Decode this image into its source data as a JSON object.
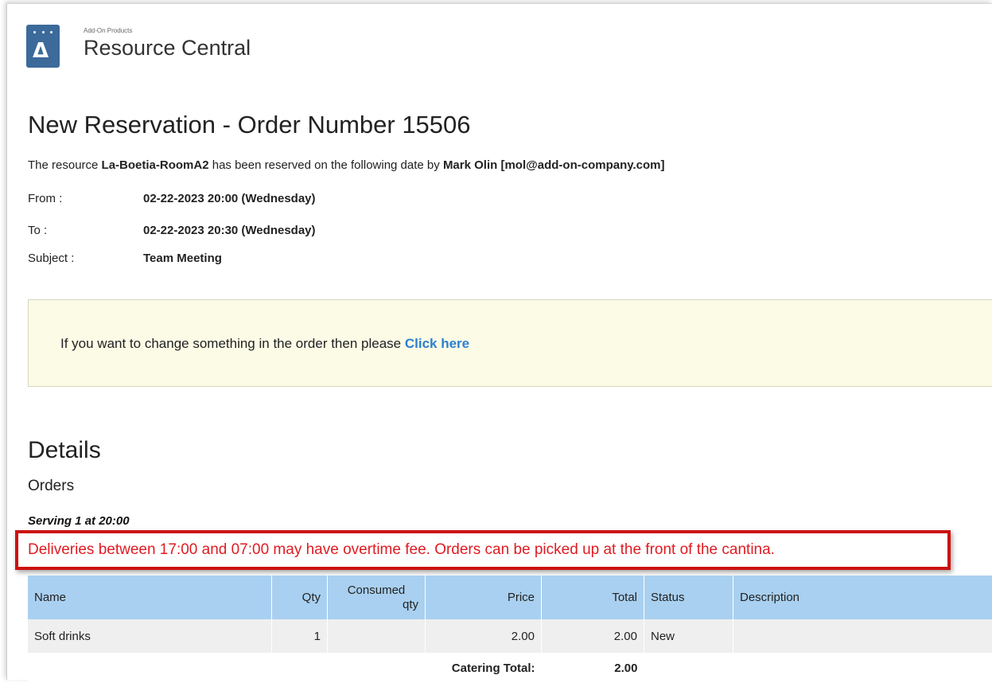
{
  "brand": {
    "small": "Add-On Products",
    "name": "Resource Central"
  },
  "title": "New Reservation - Order Number 15506",
  "intro": {
    "prefix": "The resource ",
    "resource": "La-Boetia-RoomA2",
    "middle": " has been reserved on the following date by ",
    "user": "Mark Olin [mol@add-on-company.com]"
  },
  "fields": {
    "from_label": "From :",
    "from_value": "02-22-2023 20:00 (Wednesday)",
    "to_label": "To :",
    "to_value": "02-22-2023 20:30 (Wednesday)",
    "subject_label": "Subject :",
    "subject_value": "Team Meeting"
  },
  "change": {
    "text": "If you want to change something in the order then please ",
    "link": "Click here"
  },
  "details_heading": "Details",
  "orders_heading": "Orders",
  "serving": "Serving 1 at 20:00",
  "notice": "Deliveries between 17:00 and 07:00 may have overtime fee. Orders can be picked up at the front of the cantina.",
  "table": {
    "headers": {
      "name": "Name",
      "qty": "Qty",
      "consumed_line1": "Consumed",
      "consumed_line2": "qty",
      "price": "Price",
      "total": "Total",
      "status": "Status",
      "description": "Description"
    },
    "rows": [
      {
        "name": "Soft drinks",
        "qty": "1",
        "consumed": "",
        "price": "2.00",
        "total": "2.00",
        "status": "New",
        "description": ""
      }
    ],
    "footer": {
      "label": "Catering Total:",
      "value": "2.00"
    }
  },
  "colors": {
    "header_row": "#a9d0f0",
    "notice_border": "#cc1111",
    "notice_text": "#e01b22",
    "link": "#2d7fd1",
    "change_box": "#fbfbe6"
  },
  "icons": {
    "logo": "resource-central-logo-icon"
  }
}
